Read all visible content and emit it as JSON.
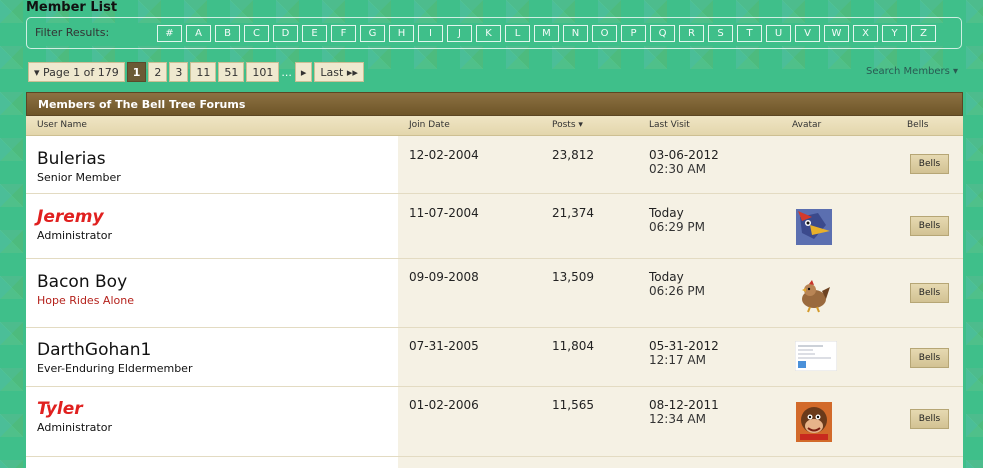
{
  "page": {
    "title": "Member List"
  },
  "filter": {
    "label": "Filter Results:",
    "letters": [
      "#",
      "A",
      "B",
      "C",
      "D",
      "E",
      "F",
      "G",
      "H",
      "I",
      "J",
      "K",
      "L",
      "M",
      "N",
      "O",
      "P",
      "Q",
      "R",
      "S",
      "T",
      "U",
      "V",
      "W",
      "X",
      "Y",
      "Z"
    ]
  },
  "pagination": {
    "page_info": "▾ Page 1 of 179",
    "pages": [
      "1",
      "2",
      "3",
      "11",
      "51",
      "101"
    ],
    "current": "1",
    "dots": "...",
    "next": "▸",
    "last": "Last ▸▸"
  },
  "search_members": "Search Members ▾",
  "panel": {
    "title": "Members of The Bell Tree Forums"
  },
  "columns": {
    "user_name": "User Name",
    "join_date": "Join Date",
    "posts": "Posts ▾",
    "last_visit": "Last Visit",
    "avatar": "Avatar",
    "bells": "Bells"
  },
  "bells_button_label": "Bells",
  "members": [
    {
      "name": "Bulerias",
      "title": "Senior Member",
      "join_date": "12-02-2004",
      "posts": "23,812",
      "last_visit_date": "03-06-2012",
      "last_visit_time": "02:30 AM",
      "avatar": "none",
      "style": "normal"
    },
    {
      "name": "Jeremy",
      "title": "Administrator",
      "join_date": "11-07-2004",
      "posts": "21,374",
      "last_visit_date": "Today",
      "last_visit_time": "06:29 PM",
      "avatar": "falco-avatar",
      "style": "admin"
    },
    {
      "name": "Bacon Boy",
      "title": "Hope Rides Alone",
      "join_date": "09-09-2008",
      "posts": "13,509",
      "last_visit_date": "Today",
      "last_visit_time": "06:26 PM",
      "avatar": "bird-avatar",
      "style": "red-title"
    },
    {
      "name": "DarthGohan1",
      "title": "Ever-Enduring Eldermember",
      "join_date": "07-31-2005",
      "posts": "11,804",
      "last_visit_date": "05-31-2012",
      "last_visit_time": "12:17 AM",
      "avatar": "card-avatar",
      "style": "normal"
    },
    {
      "name": "Tyler",
      "title": "Administrator",
      "join_date": "01-02-2006",
      "posts": "11,565",
      "last_visit_date": "08-12-2011",
      "last_visit_time": "12:34 AM",
      "avatar": "donkey-kong-avatar",
      "style": "admin"
    }
  ],
  "colors": {
    "panel_header": "#7a5f33",
    "admin_name": "#e0201f",
    "page_bg": "#3fbf8a"
  }
}
